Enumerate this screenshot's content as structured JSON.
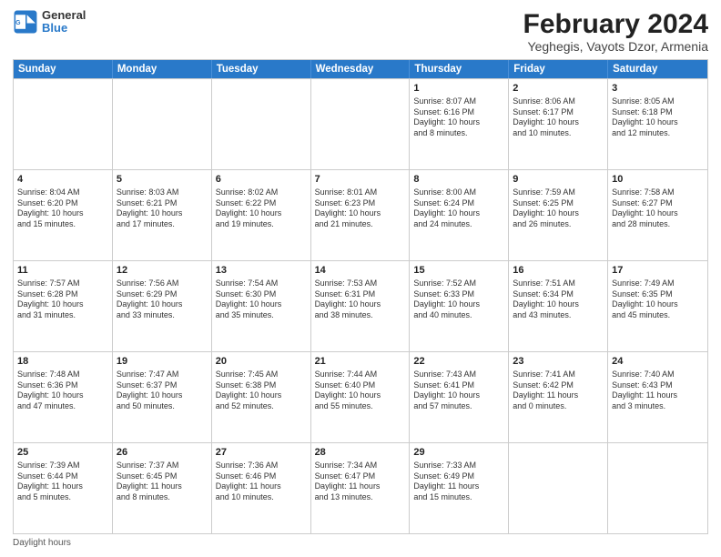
{
  "logo": {
    "line1": "General",
    "line2": "Blue"
  },
  "title": "February 2024",
  "subtitle": "Yeghegis, Vayots Dzor, Armenia",
  "days_of_week": [
    "Sunday",
    "Monday",
    "Tuesday",
    "Wednesday",
    "Thursday",
    "Friday",
    "Saturday"
  ],
  "footer_label": "Daylight hours",
  "weeks": [
    [
      {
        "day": "",
        "content": ""
      },
      {
        "day": "",
        "content": ""
      },
      {
        "day": "",
        "content": ""
      },
      {
        "day": "",
        "content": ""
      },
      {
        "day": "1",
        "content": "Sunrise: 8:07 AM\nSunset: 6:16 PM\nDaylight: 10 hours\nand 8 minutes."
      },
      {
        "day": "2",
        "content": "Sunrise: 8:06 AM\nSunset: 6:17 PM\nDaylight: 10 hours\nand 10 minutes."
      },
      {
        "day": "3",
        "content": "Sunrise: 8:05 AM\nSunset: 6:18 PM\nDaylight: 10 hours\nand 12 minutes."
      }
    ],
    [
      {
        "day": "4",
        "content": "Sunrise: 8:04 AM\nSunset: 6:20 PM\nDaylight: 10 hours\nand 15 minutes."
      },
      {
        "day": "5",
        "content": "Sunrise: 8:03 AM\nSunset: 6:21 PM\nDaylight: 10 hours\nand 17 minutes."
      },
      {
        "day": "6",
        "content": "Sunrise: 8:02 AM\nSunset: 6:22 PM\nDaylight: 10 hours\nand 19 minutes."
      },
      {
        "day": "7",
        "content": "Sunrise: 8:01 AM\nSunset: 6:23 PM\nDaylight: 10 hours\nand 21 minutes."
      },
      {
        "day": "8",
        "content": "Sunrise: 8:00 AM\nSunset: 6:24 PM\nDaylight: 10 hours\nand 24 minutes."
      },
      {
        "day": "9",
        "content": "Sunrise: 7:59 AM\nSunset: 6:25 PM\nDaylight: 10 hours\nand 26 minutes."
      },
      {
        "day": "10",
        "content": "Sunrise: 7:58 AM\nSunset: 6:27 PM\nDaylight: 10 hours\nand 28 minutes."
      }
    ],
    [
      {
        "day": "11",
        "content": "Sunrise: 7:57 AM\nSunset: 6:28 PM\nDaylight: 10 hours\nand 31 minutes."
      },
      {
        "day": "12",
        "content": "Sunrise: 7:56 AM\nSunset: 6:29 PM\nDaylight: 10 hours\nand 33 minutes."
      },
      {
        "day": "13",
        "content": "Sunrise: 7:54 AM\nSunset: 6:30 PM\nDaylight: 10 hours\nand 35 minutes."
      },
      {
        "day": "14",
        "content": "Sunrise: 7:53 AM\nSunset: 6:31 PM\nDaylight: 10 hours\nand 38 minutes."
      },
      {
        "day": "15",
        "content": "Sunrise: 7:52 AM\nSunset: 6:33 PM\nDaylight: 10 hours\nand 40 minutes."
      },
      {
        "day": "16",
        "content": "Sunrise: 7:51 AM\nSunset: 6:34 PM\nDaylight: 10 hours\nand 43 minutes."
      },
      {
        "day": "17",
        "content": "Sunrise: 7:49 AM\nSunset: 6:35 PM\nDaylight: 10 hours\nand 45 minutes."
      }
    ],
    [
      {
        "day": "18",
        "content": "Sunrise: 7:48 AM\nSunset: 6:36 PM\nDaylight: 10 hours\nand 47 minutes."
      },
      {
        "day": "19",
        "content": "Sunrise: 7:47 AM\nSunset: 6:37 PM\nDaylight: 10 hours\nand 50 minutes."
      },
      {
        "day": "20",
        "content": "Sunrise: 7:45 AM\nSunset: 6:38 PM\nDaylight: 10 hours\nand 52 minutes."
      },
      {
        "day": "21",
        "content": "Sunrise: 7:44 AM\nSunset: 6:40 PM\nDaylight: 10 hours\nand 55 minutes."
      },
      {
        "day": "22",
        "content": "Sunrise: 7:43 AM\nSunset: 6:41 PM\nDaylight: 10 hours\nand 57 minutes."
      },
      {
        "day": "23",
        "content": "Sunrise: 7:41 AM\nSunset: 6:42 PM\nDaylight: 11 hours\nand 0 minutes."
      },
      {
        "day": "24",
        "content": "Sunrise: 7:40 AM\nSunset: 6:43 PM\nDaylight: 11 hours\nand 3 minutes."
      }
    ],
    [
      {
        "day": "25",
        "content": "Sunrise: 7:39 AM\nSunset: 6:44 PM\nDaylight: 11 hours\nand 5 minutes."
      },
      {
        "day": "26",
        "content": "Sunrise: 7:37 AM\nSunset: 6:45 PM\nDaylight: 11 hours\nand 8 minutes."
      },
      {
        "day": "27",
        "content": "Sunrise: 7:36 AM\nSunset: 6:46 PM\nDaylight: 11 hours\nand 10 minutes."
      },
      {
        "day": "28",
        "content": "Sunrise: 7:34 AM\nSunset: 6:47 PM\nDaylight: 11 hours\nand 13 minutes."
      },
      {
        "day": "29",
        "content": "Sunrise: 7:33 AM\nSunset: 6:49 PM\nDaylight: 11 hours\nand 15 minutes."
      },
      {
        "day": "",
        "content": ""
      },
      {
        "day": "",
        "content": ""
      }
    ]
  ]
}
